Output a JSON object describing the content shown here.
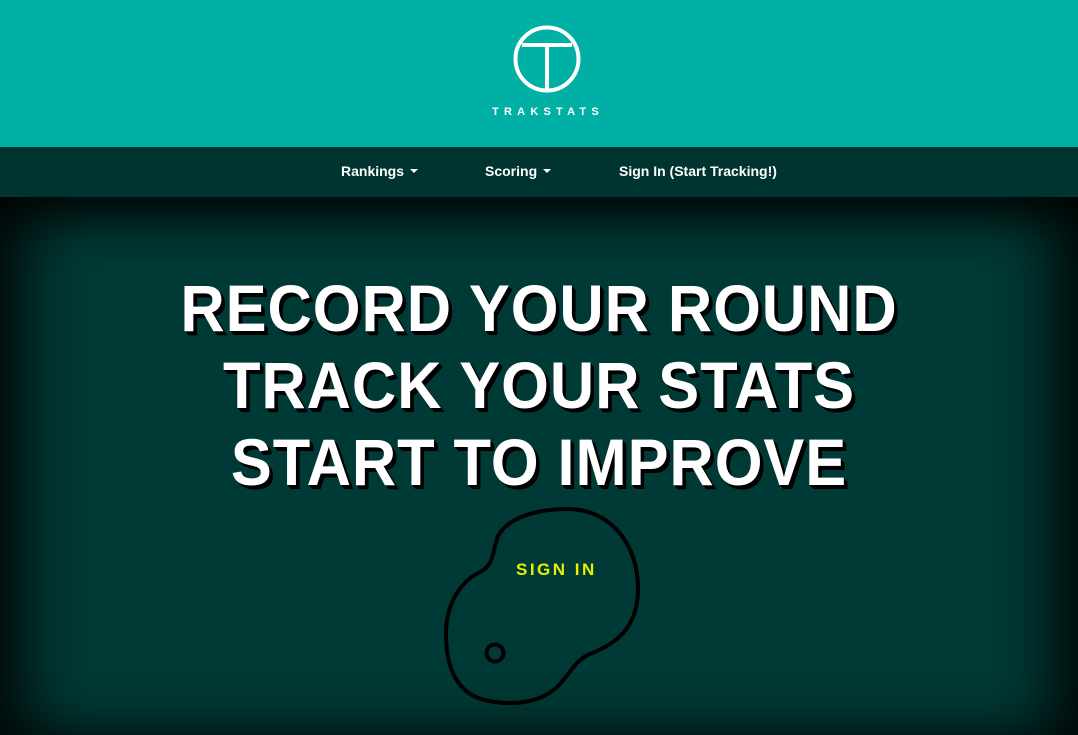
{
  "header": {
    "brand": "TRAKSTATS",
    "logo_icon": "t-circle-logo-icon",
    "background_color": "#00b0a4"
  },
  "nav": {
    "items": [
      {
        "label": "Rankings",
        "has_dropdown": true
      },
      {
        "label": "Scoring",
        "has_dropdown": true
      },
      {
        "label": "Sign In (Start Tracking!)",
        "has_dropdown": false
      }
    ],
    "background_color": "#003430"
  },
  "hero": {
    "lines": [
      "RECORD YOUR ROUND",
      "TRACK YOUR STATS",
      "START TO IMPROVE"
    ],
    "cta_label": "SIGN IN",
    "cta_icon": "golf-tee-shape-icon",
    "cta_color": "#e6f000",
    "background_color": "#003a36"
  }
}
